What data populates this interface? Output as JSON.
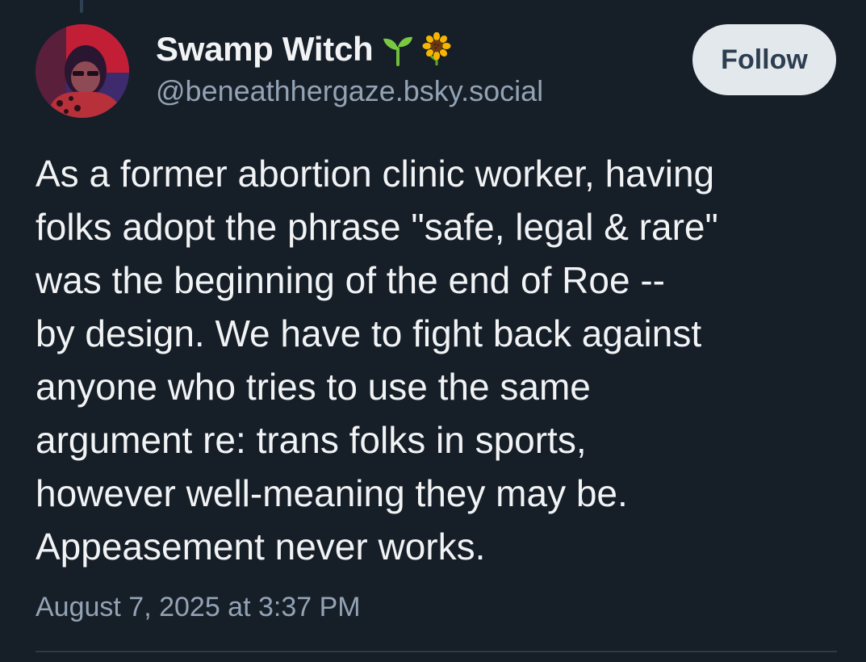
{
  "post": {
    "author": {
      "display_name": "Swamp Witch",
      "display_name_emojis": [
        "seedling-icon",
        "sunflower-icon"
      ],
      "handle": "@beneathhergaze.bsky.social"
    },
    "follow_label": "Follow",
    "text_lines": [
      "As a former abortion clinic worker, having",
      "folks adopt the phrase \"safe, legal & rare\"",
      "was the beginning of the end of Roe --",
      "by design. We have to fight back against",
      "anyone who tries to use the same",
      "argument re: trans folks in sports,",
      "however well-meaning they may be.",
      "Appeasement never works."
    ],
    "timestamp": "August 7, 2025 at 3:37 PM"
  },
  "colors": {
    "background": "#161e27",
    "primary_text": "#f1f3f5",
    "secondary_text": "#93a3b5",
    "follow_button_bg": "#e3e8ed",
    "follow_button_text": "#2c3e50",
    "divider": "#2b3a4a"
  }
}
